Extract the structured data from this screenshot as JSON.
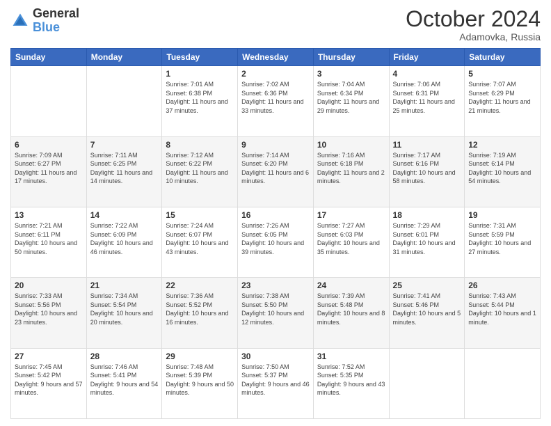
{
  "logo": {
    "text_general": "General",
    "text_blue": "Blue"
  },
  "header": {
    "month": "October 2024",
    "location": "Adamovka, Russia"
  },
  "weekdays": [
    "Sunday",
    "Monday",
    "Tuesday",
    "Wednesday",
    "Thursday",
    "Friday",
    "Saturday"
  ],
  "weeks": [
    [
      {
        "day": "",
        "info": ""
      },
      {
        "day": "",
        "info": ""
      },
      {
        "day": "1",
        "info": "Sunrise: 7:01 AM\nSunset: 6:38 PM\nDaylight: 11 hours and 37 minutes."
      },
      {
        "day": "2",
        "info": "Sunrise: 7:02 AM\nSunset: 6:36 PM\nDaylight: 11 hours and 33 minutes."
      },
      {
        "day": "3",
        "info": "Sunrise: 7:04 AM\nSunset: 6:34 PM\nDaylight: 11 hours and 29 minutes."
      },
      {
        "day": "4",
        "info": "Sunrise: 7:06 AM\nSunset: 6:31 PM\nDaylight: 11 hours and 25 minutes."
      },
      {
        "day": "5",
        "info": "Sunrise: 7:07 AM\nSunset: 6:29 PM\nDaylight: 11 hours and 21 minutes."
      }
    ],
    [
      {
        "day": "6",
        "info": "Sunrise: 7:09 AM\nSunset: 6:27 PM\nDaylight: 11 hours and 17 minutes."
      },
      {
        "day": "7",
        "info": "Sunrise: 7:11 AM\nSunset: 6:25 PM\nDaylight: 11 hours and 14 minutes."
      },
      {
        "day": "8",
        "info": "Sunrise: 7:12 AM\nSunset: 6:22 PM\nDaylight: 11 hours and 10 minutes."
      },
      {
        "day": "9",
        "info": "Sunrise: 7:14 AM\nSunset: 6:20 PM\nDaylight: 11 hours and 6 minutes."
      },
      {
        "day": "10",
        "info": "Sunrise: 7:16 AM\nSunset: 6:18 PM\nDaylight: 11 hours and 2 minutes."
      },
      {
        "day": "11",
        "info": "Sunrise: 7:17 AM\nSunset: 6:16 PM\nDaylight: 10 hours and 58 minutes."
      },
      {
        "day": "12",
        "info": "Sunrise: 7:19 AM\nSunset: 6:14 PM\nDaylight: 10 hours and 54 minutes."
      }
    ],
    [
      {
        "day": "13",
        "info": "Sunrise: 7:21 AM\nSunset: 6:11 PM\nDaylight: 10 hours and 50 minutes."
      },
      {
        "day": "14",
        "info": "Sunrise: 7:22 AM\nSunset: 6:09 PM\nDaylight: 10 hours and 46 minutes."
      },
      {
        "day": "15",
        "info": "Sunrise: 7:24 AM\nSunset: 6:07 PM\nDaylight: 10 hours and 43 minutes."
      },
      {
        "day": "16",
        "info": "Sunrise: 7:26 AM\nSunset: 6:05 PM\nDaylight: 10 hours and 39 minutes."
      },
      {
        "day": "17",
        "info": "Sunrise: 7:27 AM\nSunset: 6:03 PM\nDaylight: 10 hours and 35 minutes."
      },
      {
        "day": "18",
        "info": "Sunrise: 7:29 AM\nSunset: 6:01 PM\nDaylight: 10 hours and 31 minutes."
      },
      {
        "day": "19",
        "info": "Sunrise: 7:31 AM\nSunset: 5:59 PM\nDaylight: 10 hours and 27 minutes."
      }
    ],
    [
      {
        "day": "20",
        "info": "Sunrise: 7:33 AM\nSunset: 5:56 PM\nDaylight: 10 hours and 23 minutes."
      },
      {
        "day": "21",
        "info": "Sunrise: 7:34 AM\nSunset: 5:54 PM\nDaylight: 10 hours and 20 minutes."
      },
      {
        "day": "22",
        "info": "Sunrise: 7:36 AM\nSunset: 5:52 PM\nDaylight: 10 hours and 16 minutes."
      },
      {
        "day": "23",
        "info": "Sunrise: 7:38 AM\nSunset: 5:50 PM\nDaylight: 10 hours and 12 minutes."
      },
      {
        "day": "24",
        "info": "Sunrise: 7:39 AM\nSunset: 5:48 PM\nDaylight: 10 hours and 8 minutes."
      },
      {
        "day": "25",
        "info": "Sunrise: 7:41 AM\nSunset: 5:46 PM\nDaylight: 10 hours and 5 minutes."
      },
      {
        "day": "26",
        "info": "Sunrise: 7:43 AM\nSunset: 5:44 PM\nDaylight: 10 hours and 1 minute."
      }
    ],
    [
      {
        "day": "27",
        "info": "Sunrise: 7:45 AM\nSunset: 5:42 PM\nDaylight: 9 hours and 57 minutes."
      },
      {
        "day": "28",
        "info": "Sunrise: 7:46 AM\nSunset: 5:41 PM\nDaylight: 9 hours and 54 minutes."
      },
      {
        "day": "29",
        "info": "Sunrise: 7:48 AM\nSunset: 5:39 PM\nDaylight: 9 hours and 50 minutes."
      },
      {
        "day": "30",
        "info": "Sunrise: 7:50 AM\nSunset: 5:37 PM\nDaylight: 9 hours and 46 minutes."
      },
      {
        "day": "31",
        "info": "Sunrise: 7:52 AM\nSunset: 5:35 PM\nDaylight: 9 hours and 43 minutes."
      },
      {
        "day": "",
        "info": ""
      },
      {
        "day": "",
        "info": ""
      }
    ]
  ]
}
